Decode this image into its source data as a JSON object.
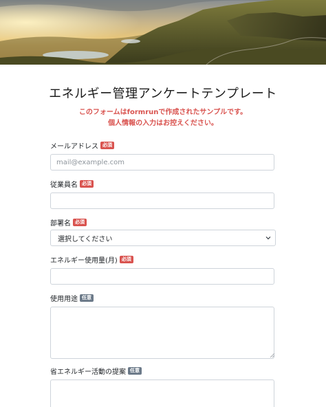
{
  "form": {
    "title": "エネルギー管理アンケートテンプレート",
    "notice_line1": "このフォームはformrunで作成されたサンプルです。",
    "notice_line2": "個人情報の入力はお控えください。"
  },
  "badges": {
    "required": "必須",
    "optional": "任意"
  },
  "fields": {
    "email": {
      "label": "メールアドレス",
      "placeholder": "mail@example.com",
      "value": ""
    },
    "employee_name": {
      "label": "従業員名",
      "value": ""
    },
    "department": {
      "label": "部署名",
      "selected": "選択してください"
    },
    "energy_usage": {
      "label": "エネルギー使用量(月)",
      "value": ""
    },
    "usage_purpose": {
      "label": "使用用途",
      "value": ""
    },
    "energy_saving": {
      "label": "省エネルギー活動の提案",
      "value": ""
    }
  },
  "icons": {
    "select_arrow": "chevron-down-icon",
    "textarea_grip": "resize-grip-icon"
  },
  "colors": {
    "required_badge": "#d9534f",
    "optional_badge": "#6c7a89",
    "notice_text": "#d9534f",
    "input_border": "#ced4da"
  }
}
